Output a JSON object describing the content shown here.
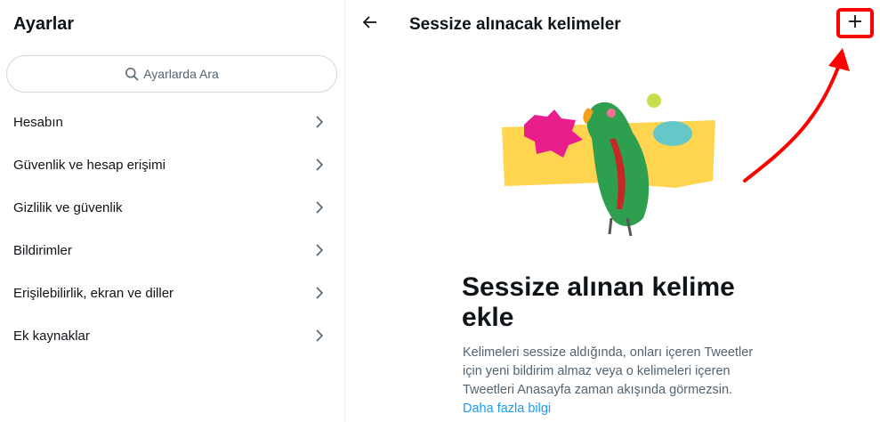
{
  "sidebar": {
    "title": "Ayarlar",
    "search": {
      "placeholder": "Ayarlarda Ara"
    },
    "items": [
      {
        "label": "Hesabın"
      },
      {
        "label": "Güvenlik ve hesap erişimi"
      },
      {
        "label": "Gizlilik ve güvenlik"
      },
      {
        "label": "Bildirimler"
      },
      {
        "label": "Erişilebilirlik, ekran ve diller"
      },
      {
        "label": "Ek kaynaklar"
      }
    ]
  },
  "header": {
    "title": "Sessize alınacak kelimeler",
    "back_icon": "arrow-left-icon",
    "add_icon": "plus-icon"
  },
  "empty_state": {
    "heading": "Sessize alınan kelime ekle",
    "description": "Kelimeleri sessize aldığında, onları içeren Tweetler için yeni bildirim almaz veya o kelimeleri içeren Tweetleri Anasayfa zaman akışında görmezsin.",
    "link": "Daha fazla bilgi",
    "illustration": "parrot-illustration"
  },
  "colors": {
    "accent": "#1d9bf0",
    "annotation": "#ff0000",
    "text_primary": "#0f1419",
    "text_secondary": "#536471",
    "border": "#eff3f4"
  }
}
